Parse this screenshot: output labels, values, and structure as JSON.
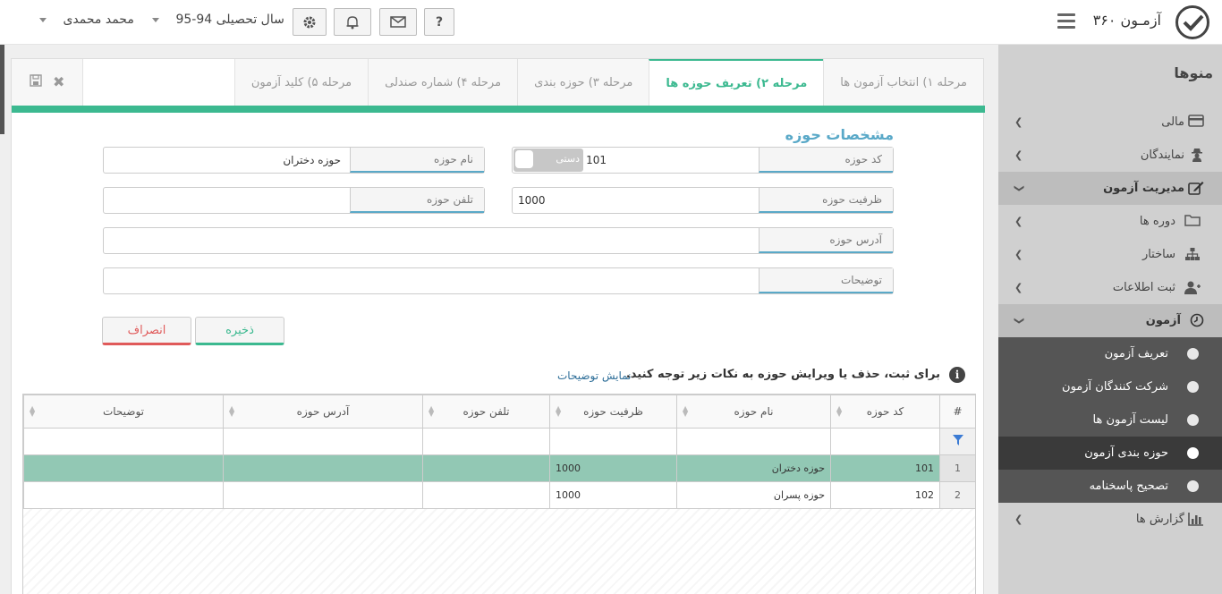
{
  "app": {
    "brand": "آزمـون ۳۶۰"
  },
  "topbar": {
    "user_name": "محمد محمدی",
    "academic_year": "سال تحصیلی 94-95",
    "help_label": "?"
  },
  "sidebar": {
    "title": "منوها",
    "items": [
      {
        "label": "مالی",
        "icon": "credit-card-icon"
      },
      {
        "label": "نمایندگان",
        "icon": "user-secret-icon"
      },
      {
        "label": "مدیریت آزمون",
        "icon": "edit-icon"
      },
      {
        "label": "دوره ها",
        "icon": "folder-icon"
      },
      {
        "label": "ساختار",
        "icon": "sitemap-icon"
      },
      {
        "label": "ثبت اطلاعات",
        "icon": "user-plus-icon"
      },
      {
        "label": "آزمون",
        "icon": "clock-icon"
      },
      {
        "label": "تعریف آزمون"
      },
      {
        "label": "شرکت کنندگان آزمون"
      },
      {
        "label": "لیست آزمون ها"
      },
      {
        "label": "حوزه بندی آزمون"
      },
      {
        "label": "تصحیح پاسخنامه"
      },
      {
        "label": "گزارش ها",
        "icon": "bar-chart-icon"
      }
    ]
  },
  "tabs": [
    {
      "label": "مرحله ۱) انتخاب آزمون ها"
    },
    {
      "label": "مرحله ۲) تعریف حوزه ها"
    },
    {
      "label": "مرحله ۳) حوزه بندی"
    },
    {
      "label": "مرحله ۴) شماره صندلی"
    },
    {
      "label": "مرحله ۵) کلید آزمون"
    }
  ],
  "form": {
    "section_title": "مشخصات حوزه",
    "code_label": "کد حوزه",
    "code_value": "101",
    "manual_toggle": "دستی",
    "name_label": "نام حوزه",
    "name_value": "حوزه دختران",
    "capacity_label": "ظرفیت حوزه",
    "capacity_value": "1000",
    "phone_label": "تلفن حوزه",
    "phone_value": "",
    "address_label": "آدرس حوزه",
    "address_value": "",
    "desc_label": "توضیحات",
    "desc_value": "",
    "save_label": "ذخیره",
    "cancel_label": "انصراف"
  },
  "notice": {
    "text": "برای ثبت، حذف یا ویرایش حوزه به نکات زیر توجه کنید.",
    "link": "نمایش توضیحات"
  },
  "grid": {
    "columns": [
      "#",
      "کد حوزه",
      "نام حوزه",
      "ظرفیت حوزه",
      "تلفن حوزه",
      "آدرس حوزه",
      "توضیحات"
    ],
    "rows": [
      {
        "idx": "1",
        "code": "101",
        "name": "حوزه دختران",
        "capacity": "1000",
        "phone": "",
        "address": "",
        "desc": ""
      },
      {
        "idx": "2",
        "code": "102",
        "name": "حوزه پسران",
        "capacity": "1000",
        "phone": "",
        "address": "",
        "desc": ""
      }
    ]
  },
  "colors": {
    "accent": "#3cb990",
    "label_underline": "#5aa9c8",
    "cancel": "#e05a5a"
  }
}
